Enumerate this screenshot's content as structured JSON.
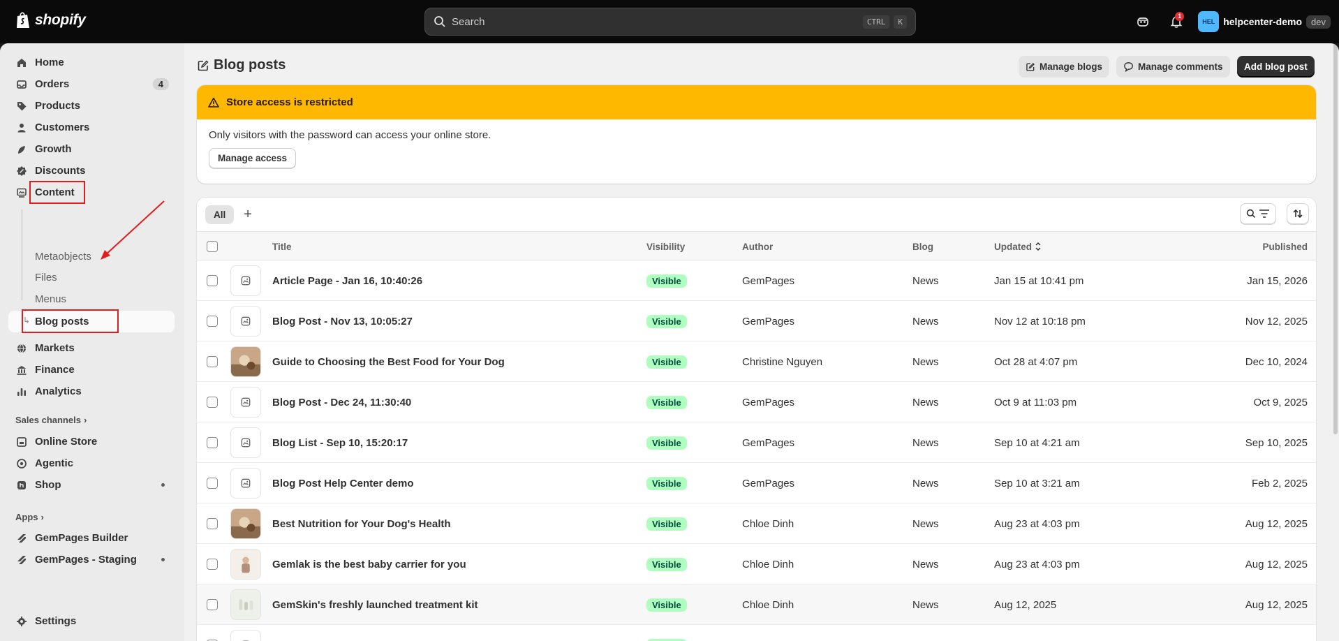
{
  "topbar": {
    "brand": "shopify",
    "search_placeholder": "Search",
    "shortcut_ctrl": "CTRL",
    "shortcut_key": "K",
    "notification_count": "1",
    "store_initials": "HEL",
    "store_name": "helpcenter-demo",
    "store_env": "dev"
  },
  "sidebar": {
    "items": [
      {
        "label": "Home",
        "icon": "home-icon"
      },
      {
        "label": "Orders",
        "icon": "inbox-icon",
        "badge": "4"
      },
      {
        "label": "Products",
        "icon": "tag-icon"
      },
      {
        "label": "Customers",
        "icon": "person-icon"
      },
      {
        "label": "Growth",
        "icon": "growth-icon"
      },
      {
        "label": "Discounts",
        "icon": "discount-icon"
      },
      {
        "label": "Content",
        "icon": "content-icon"
      }
    ],
    "content_sub": [
      "Metaobjects",
      "Files",
      "Menus"
    ],
    "active_sub": "Blog posts",
    "items2": [
      {
        "label": "Markets",
        "icon": "globe-icon"
      },
      {
        "label": "Finance",
        "icon": "bank-icon"
      },
      {
        "label": "Analytics",
        "icon": "chart-icon"
      }
    ],
    "sales_channels_title": "Sales channels",
    "sales_channels": [
      {
        "label": "Online Store",
        "icon": "store-icon"
      },
      {
        "label": "Agentic",
        "icon": "agentic-icon"
      },
      {
        "label": "Shop",
        "icon": "shop-icon"
      }
    ],
    "apps_title": "Apps",
    "apps": [
      {
        "label": "GemPages Builder",
        "icon": "gempages-icon"
      },
      {
        "label": "GemPages - Staging",
        "icon": "gempages-icon"
      }
    ],
    "settings": "Settings"
  },
  "page": {
    "title": "Blog posts",
    "manage_blogs": "Manage blogs",
    "manage_comments": "Manage comments",
    "add_blog_post": "Add blog post"
  },
  "banner": {
    "title": "Store access is restricted",
    "body": "Only visitors with the password can access your online store.",
    "button": "Manage access"
  },
  "table": {
    "tab_all": "All",
    "tab_add": "+",
    "headers": {
      "title": "Title",
      "visibility": "Visibility",
      "author": "Author",
      "blog": "Blog",
      "updated": "Updated",
      "published": "Published"
    },
    "rows": [
      {
        "title": "Article Page - Jan 16, 10:40:26",
        "visibility": "Visible",
        "author": "GemPages",
        "blog": "News",
        "updated": "Jan 15 at 10:41 pm",
        "published": "Jan 15, 2026",
        "thumb": "placeholder"
      },
      {
        "title": "Blog Post - Nov 13, 10:05:27",
        "visibility": "Visible",
        "author": "GemPages",
        "blog": "News",
        "updated": "Nov 12 at 10:18 pm",
        "published": "Nov 12, 2025",
        "thumb": "placeholder"
      },
      {
        "title": "Guide to Choosing the Best Food for Your Dog",
        "visibility": "Visible",
        "author": "Christine Nguyen",
        "blog": "News",
        "updated": "Oct 28 at 4:07 pm",
        "published": "Dec 10, 2024",
        "thumb": "dog-photo"
      },
      {
        "title": "Blog Post - Dec 24, 11:30:40",
        "visibility": "Visible",
        "author": "GemPages",
        "blog": "News",
        "updated": "Oct 9 at 11:03 pm",
        "published": "Oct 9, 2025",
        "thumb": "placeholder"
      },
      {
        "title": "Blog List - Sep 10, 15:20:17",
        "visibility": "Visible",
        "author": "GemPages",
        "blog": "News",
        "updated": "Sep 10 at 4:21 am",
        "published": "Sep 10, 2025",
        "thumb": "placeholder"
      },
      {
        "title": "Blog Post Help Center demo",
        "visibility": "Visible",
        "author": "GemPages",
        "blog": "News",
        "updated": "Sep 10 at 3:21 am",
        "published": "Feb 2, 2025",
        "thumb": "placeholder"
      },
      {
        "title": "Best Nutrition for Your Dog's Health",
        "visibility": "Visible",
        "author": "Chloe Dinh",
        "blog": "News",
        "updated": "Aug 23 at 4:03 pm",
        "published": "Aug 12, 2025",
        "thumb": "dog-photo"
      },
      {
        "title": "Gemlak is the best baby carrier for you",
        "visibility": "Visible",
        "author": "Chloe Dinh",
        "blog": "News",
        "updated": "Aug 23 at 4:03 pm",
        "published": "Aug 12, 2025",
        "thumb": "baby-photo"
      },
      {
        "title": "GemSkin's freshly launched treatment kit",
        "visibility": "Visible",
        "author": "Chloe Dinh",
        "blog": "News",
        "updated": "Aug 12, 2025",
        "published": "Aug 12, 2025",
        "thumb": "skincare-photo"
      },
      {
        "title": "",
        "visibility": "Visible",
        "author": "",
        "blog": "",
        "updated": "",
        "published": "",
        "thumb": "placeholder"
      }
    ]
  },
  "colors": {
    "banner": "#ffb800",
    "visible_badge": "#affebf",
    "annotation": "#e21d1d"
  }
}
